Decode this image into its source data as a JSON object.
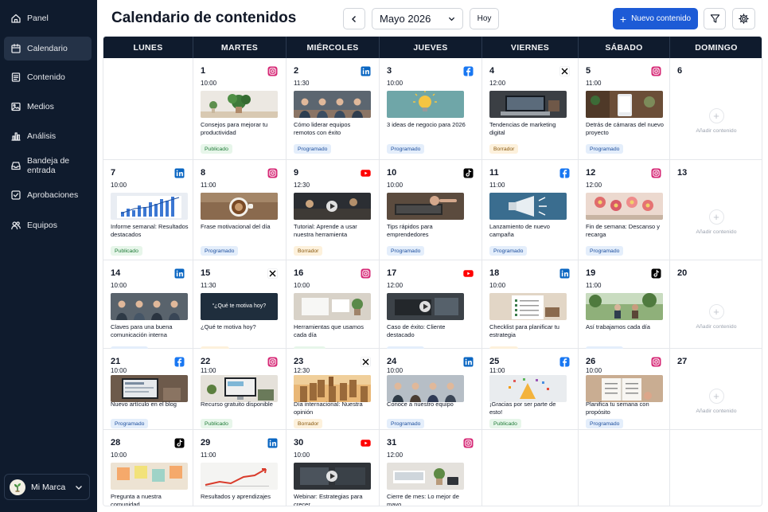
{
  "sidebar": {
    "items": [
      {
        "label": "Panel",
        "icon": "home-icon",
        "active": false
      },
      {
        "label": "Calendario",
        "icon": "calendar-icon",
        "active": true
      },
      {
        "label": "Contenido",
        "icon": "document-icon",
        "active": false
      },
      {
        "label": "Medios",
        "icon": "image-icon",
        "active": false
      },
      {
        "label": "Análisis",
        "icon": "bar-chart-icon",
        "active": false
      },
      {
        "label": "Bandeja de entrada",
        "icon": "inbox-icon",
        "active": false
      },
      {
        "label": "Aprobaciones",
        "icon": "check-square-icon",
        "active": false
      },
      {
        "label": "Equipos",
        "icon": "users-icon",
        "active": false
      }
    ],
    "brand": {
      "name": "Mi Marca",
      "icon": "plant-logo-icon"
    }
  },
  "header": {
    "title": "Calendario de contenidos",
    "month": "Mayo 2026",
    "today_label": "Hoy",
    "new_label": "Nuevo contenido"
  },
  "calendar": {
    "weekdays": [
      "LUNES",
      "MARTES",
      "MIÉRCOLES",
      "JUEVES",
      "VIERNES",
      "SÁBADO",
      "DOMINGO"
    ],
    "add_label": "Añadir contenido",
    "status_labels": {
      "pub": "Publicado",
      "prog": "Programado",
      "borr": "Borrador"
    },
    "colors": {
      "header": "#0f1b2d",
      "accent": "#1d5bd6",
      "instagram": "#d62976",
      "linkedin": "#0a66c2",
      "facebook": "#1877f2",
      "youtube": "#ff0000",
      "x": "#000000",
      "tiktok": "#000000"
    },
    "weeks": [
      [
        null,
        {
          "day": "1",
          "platform": "instagram",
          "time": "10:00",
          "thumb": "plants",
          "title": "Consejos para mejorar tu productividad",
          "status": "pub"
        },
        {
          "day": "2",
          "platform": "linkedin",
          "time": "11:30",
          "thumb": "meeting",
          "title": "Cómo liderar equipos remotos con éxito",
          "status": "prog"
        },
        {
          "day": "3",
          "platform": "facebook",
          "time": "10:00",
          "thumb": "bulb",
          "title": "3 ideas de negocio para 2026",
          "status": "prog"
        },
        {
          "day": "4",
          "platform": "x",
          "time": "12:00",
          "thumb": "laptop",
          "title": "Tendencias de marketing digital",
          "status": "borr"
        },
        {
          "day": "5",
          "platform": "instagram",
          "time": "11:00",
          "thumb": "phone",
          "title": "Detrás de cámaras del nuevo proyecto",
          "status": "prog"
        },
        {
          "day": "6",
          "empty": true
        }
      ],
      [
        {
          "day": "7",
          "platform": "linkedin",
          "time": "10:00",
          "thumb": "chart",
          "title": "Informe semanal: Resultados destacados",
          "status": "pub"
        },
        {
          "day": "8",
          "platform": "instagram",
          "time": "11:00",
          "thumb": "coffee",
          "title": "Frase motivacional del día",
          "status": "prog"
        },
        {
          "day": "9",
          "platform": "youtube",
          "time": "12:30",
          "thumb": "video",
          "title": "Tutorial: Aprende a usar nuestra herramienta",
          "status": "borr"
        },
        {
          "day": "10",
          "platform": "tiktok",
          "time": "10:00",
          "thumb": "typing",
          "title": "Tips rápidos para emprendedores",
          "status": "prog"
        },
        {
          "day": "11",
          "platform": "facebook",
          "time": "11:00",
          "thumb": "megaphone",
          "title": "Lanzamiento de nuevo campaña",
          "status": "prog"
        },
        {
          "day": "12",
          "platform": "instagram",
          "time": "12:00",
          "thumb": "flowers",
          "title": "Fin de semana: Descanso y recarga",
          "status": "prog"
        },
        {
          "day": "13",
          "empty": true
        }
      ],
      [
        {
          "day": "14",
          "platform": "linkedin",
          "time": "10:00",
          "thumb": "talk",
          "title": "Claves para una buena comunicación interna",
          "status": "prog"
        },
        {
          "day": "15",
          "platform": "x",
          "time": "11:30",
          "thumb": "quote",
          "thumb_text": "“¿Qué te motiva hoy?",
          "title": "¿Qué te motiva hoy?",
          "status": "borr"
        },
        {
          "day": "16",
          "platform": "instagram",
          "time": "10:00",
          "thumb": "desk",
          "title": "Herramientas que usamos cada día",
          "status": "pub"
        },
        {
          "day": "17",
          "platform": "youtube",
          "time": "12:00",
          "thumb": "video2",
          "title": "Caso de éxito: Cliente destacado",
          "status": "prog"
        },
        {
          "day": "18",
          "platform": "linkedin",
          "time": "10:00",
          "thumb": "checklist",
          "title": "Checklist para planificar tu estrategia",
          "status": "borr"
        },
        {
          "day": "19",
          "platform": "tiktok",
          "time": "11:00",
          "thumb": "park",
          "title": "Así trabajamos cada día",
          "status": "prog"
        },
        {
          "day": "20",
          "empty": true
        }
      ],
      [
        {
          "day": "21",
          "platform": "facebook",
          "time": "10:00",
          "thumb": "blog",
          "title": "Nuevo artículo en el blog",
          "status": "prog"
        },
        {
          "day": "22",
          "platform": "instagram",
          "time": "11:00",
          "thumb": "monitor",
          "title": "Recurso gratuito disponible",
          "status": "pub"
        },
        {
          "day": "23",
          "platform": "x",
          "time": "12:30",
          "thumb": "city",
          "title": "Día internacional: Nuestra opinión",
          "status": "borr"
        },
        {
          "day": "24",
          "platform": "linkedin",
          "time": "10:00",
          "thumb": "team",
          "title": "Conoce a nuestro equipo",
          "status": "prog"
        },
        {
          "day": "25",
          "platform": "facebook",
          "time": "11:00",
          "thumb": "confetti",
          "title": "¡Gracias por ser parte de esto!",
          "status": "pub"
        },
        {
          "day": "26",
          "platform": "instagram",
          "time": "10:00",
          "thumb": "notebook",
          "title": "Planifica tu semana con propósito",
          "status": "prog"
        },
        {
          "day": "27",
          "empty": true
        }
      ],
      [
        {
          "day": "28",
          "platform": "tiktok",
          "time": "10:00",
          "thumb": "notes",
          "title": "Pregunta a nuestra comunidad",
          "status": "borr"
        },
        {
          "day": "29",
          "platform": "linkedin",
          "time": "11:00",
          "thumb": "growth",
          "title": "Resultados y aprendizajes",
          "status": "prog"
        },
        {
          "day": "30",
          "platform": "youtube",
          "time": "10:00",
          "thumb": "video3",
          "title": "Webinar: Estrategias para crecer",
          "status": "pub"
        },
        {
          "day": "31",
          "platform": "instagram",
          "time": "12:00",
          "thumb": "workspace",
          "title": "Cierre de mes: Lo mejor de mayo",
          "status": "prog"
        },
        null,
        null,
        null
      ]
    ]
  }
}
